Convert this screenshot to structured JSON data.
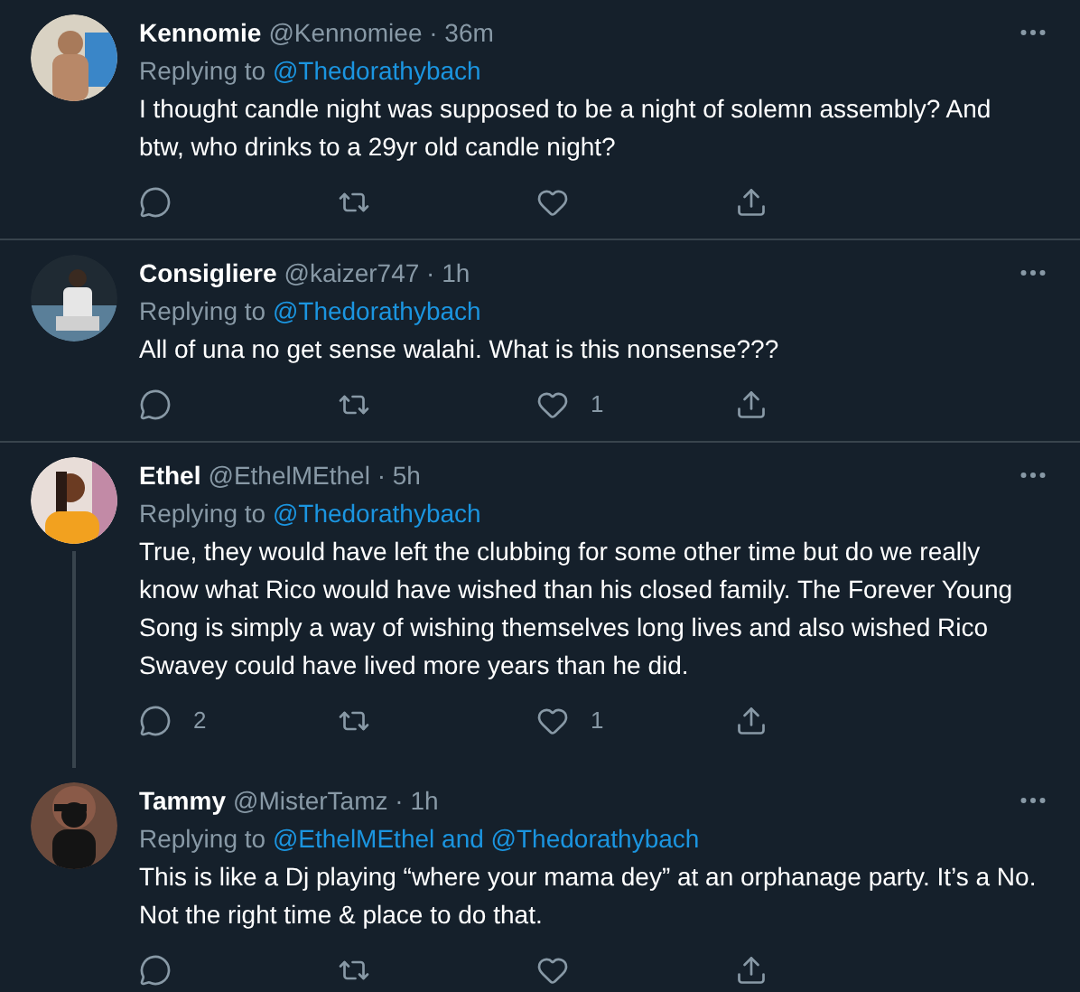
{
  "tweets": [
    {
      "name": "Kennomie",
      "handle": "@Kennomiee",
      "separator": "·",
      "time": "36m",
      "replying_label": "Replying to",
      "mentions": [
        "@Thedorathybach"
      ],
      "text": "I thought candle night was supposed to be a night of solemn assembly? And btw, who drinks to a 29yr old candle night?",
      "thread_continues": false
    },
    {
      "name": "Consigliere",
      "handle": "@kaizer747",
      "separator": "·",
      "time": "1h",
      "replying_label": "Replying to",
      "mentions": [
        "@Thedorathybach"
      ],
      "text": "All of una no get sense walahi. What is this nonsense???",
      "likes": "1",
      "thread_continues": false
    },
    {
      "name": "Ethel",
      "handle": "@EthelMEthel",
      "separator": "·",
      "time": "5h",
      "replying_label": "Replying to",
      "mentions": [
        "@Thedorathybach"
      ],
      "text": "True, they would have left the clubbing for some other time but do we really know what Rico would have wished than his closed family. The Forever Young Song is simply a way of wishing themselves long lives and also wished Rico Swavey could have lived more years than he did.",
      "replies": "2",
      "likes": "1",
      "thread_continues": true
    },
    {
      "name": "Tammy",
      "handle": "@MisterTamz",
      "separator": "·",
      "time": "1h",
      "replying_label": "Replying to",
      "mentions": [
        "@EthelMEthel",
        "@Thedorathybach"
      ],
      "joiner": "and",
      "text": "This is like a Dj playing “where your mama dey” at an orphanage party. It’s a No. Not the right time & place to do that.",
      "thread_continues": false
    }
  ]
}
